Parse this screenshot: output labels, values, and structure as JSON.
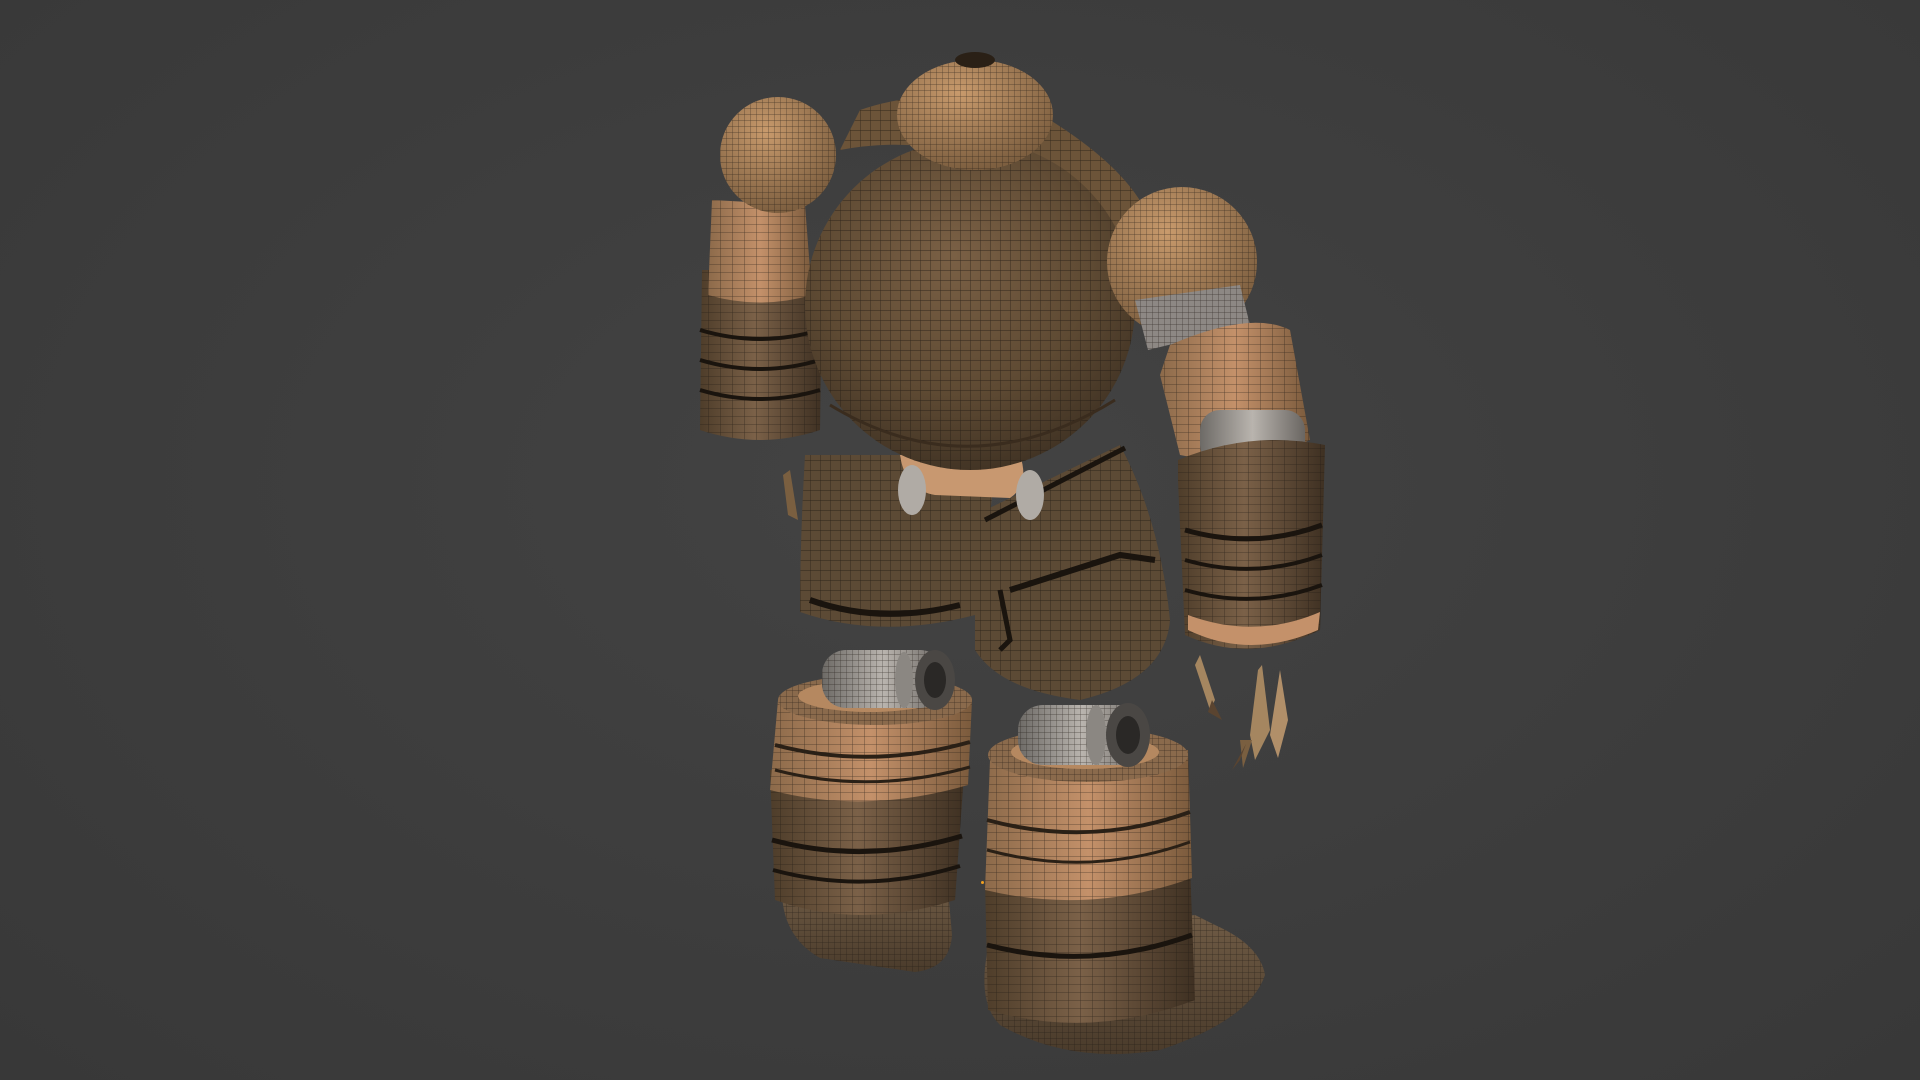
{
  "viewport": {
    "background": "#3d3d3d",
    "mode": "solid-wireframe-overlay"
  },
  "model": {
    "name": "robot-mesh",
    "material_base": "#6b5338",
    "material_light": "#b8895f",
    "material_dark": "#3a2c1e",
    "wire_color": "#1e1812",
    "metal_color": "#9a9590",
    "parts": [
      "head-dome",
      "torso-sphere",
      "left-shoulder",
      "right-shoulder",
      "left-upper-arm",
      "right-upper-arm",
      "left-forearm",
      "right-forearm",
      "right-claw",
      "pelvis",
      "left-knee-joint",
      "right-knee-joint",
      "left-shin",
      "right-shin",
      "left-foot",
      "right-foot"
    ]
  }
}
